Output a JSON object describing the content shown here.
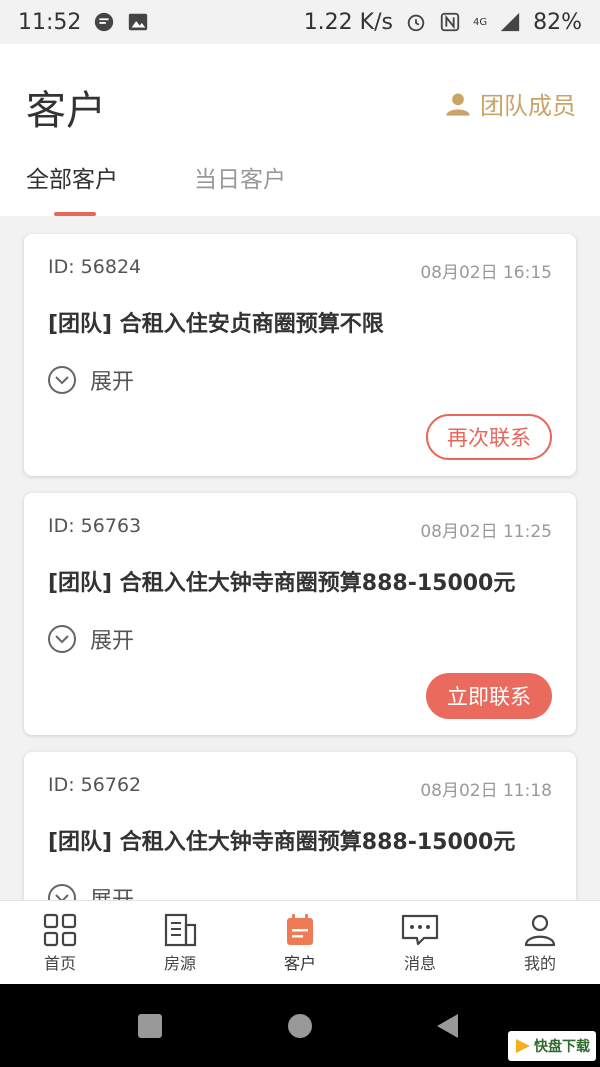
{
  "status_bar": {
    "time": "11:52",
    "network_speed": "1.22 K/s",
    "network_type": "4G",
    "battery": "82%"
  },
  "header": {
    "title": "客户",
    "team_label": "团队成员"
  },
  "tabs": [
    {
      "label": "全部客户",
      "active": true
    },
    {
      "label": "当日客户",
      "active": false
    }
  ],
  "cards": [
    {
      "id": "ID: 56824",
      "time": "08月02日 16:15",
      "title": "[团队] 合租入住安贞商圈预算不限",
      "expand_label": "展开",
      "action_label": "再次联系",
      "action_style": "outline"
    },
    {
      "id": "ID: 56763",
      "time": "08月02日 11:25",
      "title": "[团队] 合租入住大钟寺商圈预算888-15000元",
      "expand_label": "展开",
      "action_label": "立即联系",
      "action_style": "filled"
    },
    {
      "id": "ID: 56762",
      "time": "08月02日 11:18",
      "title": "[团队] 合租入住大钟寺商圈预算888-15000元",
      "expand_label": "展开"
    }
  ],
  "bottom_nav": [
    {
      "label": "首页",
      "icon": "grid-icon"
    },
    {
      "label": "房源",
      "icon": "building-icon"
    },
    {
      "label": "客户",
      "icon": "calendar-icon",
      "active": true
    },
    {
      "label": "消息",
      "icon": "chat-icon"
    },
    {
      "label": "我的",
      "icon": "person-icon"
    }
  ],
  "watermark": {
    "text": "快盘下载"
  },
  "colors": {
    "accent": "#e8675a",
    "gold": "#c9a466"
  }
}
